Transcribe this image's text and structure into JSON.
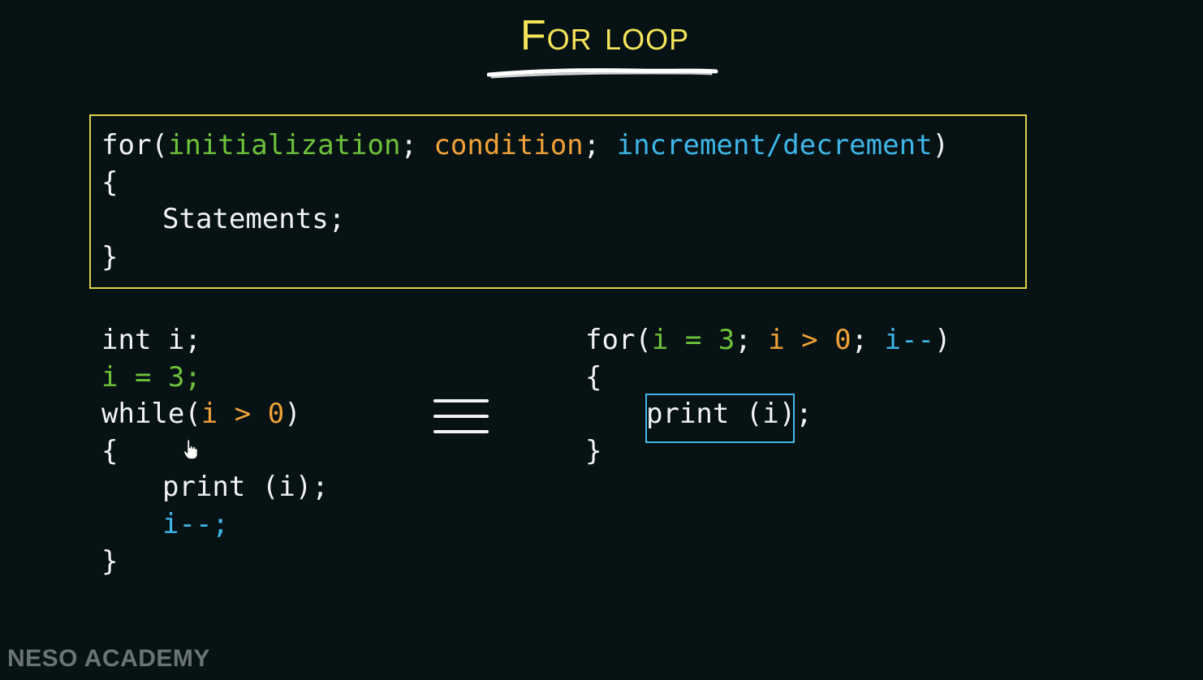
{
  "title": "For loop",
  "syntax": {
    "line1": {
      "kw": "for(",
      "init": "initialization",
      "sep1": "; ",
      "cond": "condition",
      "sep2": "; ",
      "incr": "increment/decrement",
      "close": ")"
    },
    "line2": "{",
    "line3": "Statements;",
    "line4": "}"
  },
  "while_example": {
    "line1": "int i;",
    "line2": "i = 3;",
    "line3": {
      "kw": "while(",
      "cond": "i > 0",
      "close": ")"
    },
    "line4": "{",
    "line5": "print (i);",
    "line6": "i--;",
    "line7": "}"
  },
  "equivalence_symbol": "≡",
  "for_example": {
    "line1": {
      "kw": "for(",
      "init": "i = 3",
      "sep1": "; ",
      "cond": "i > 0",
      "sep2": "; ",
      "incr": "i--",
      "close": ")"
    },
    "line2": "{",
    "line3_boxed": "print (i)",
    "line3_tail": ";",
    "line4": "}"
  },
  "brand": "NESO ACADEMY",
  "colors": {
    "background": "#061214",
    "title": "#f5e35a",
    "box_border": "#e0d04a",
    "initialization": "#6ec23a",
    "condition": "#f0a238",
    "increment": "#3fb6e8",
    "highlight_border": "#3fb6e8",
    "brand": "#7c8486"
  },
  "icons": {
    "cursor": "hand-pointer-icon"
  }
}
